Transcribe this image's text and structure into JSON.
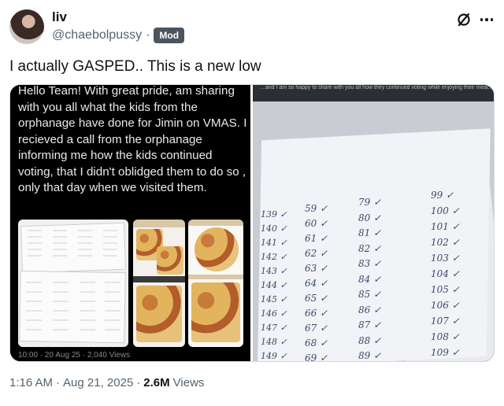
{
  "author": {
    "display_name": "liv",
    "handle": "@chaebolpussy",
    "separator": "·",
    "badge": "Mod"
  },
  "actions": {
    "grok_icon": "slashed-circle-icon",
    "more_icon": "more-dots-icon"
  },
  "tweet": {
    "text": "I actually GASPED.. This is a new low"
  },
  "media": {
    "left_caption": "Hello Team! With great pride, am sharing with you all what the kids from the orphanage have done for Jimin on VMAS. I recieved a call from the orphanage informing me how the kids continued voting, that I didn't oblidged them to do so , only that day when we visited them.",
    "left_bottom_fragment": "10:00 · 20 Aug 25 · 2,040 Views",
    "right_top_fragment": "...and I am so happy to share with you all how they continued voting while enjoying their meal...",
    "sheet_columns": [
      [
        "139",
        "140",
        "141",
        "142",
        "143",
        "144",
        "145",
        "146",
        "147",
        "148",
        "149"
      ],
      [
        "59",
        "60",
        "61",
        "62",
        "63",
        "64",
        "65",
        "66",
        "67",
        "68",
        "69"
      ],
      [
        "79",
        "80",
        "81",
        "82",
        "83",
        "84",
        "85",
        "86",
        "87",
        "88",
        "89"
      ],
      [
        "99",
        "100",
        "101",
        "102",
        "103",
        "104",
        "105",
        "106",
        "107",
        "108",
        "109"
      ]
    ]
  },
  "footer": {
    "time": "1:16 AM",
    "dot1": "·",
    "date": "Aug 21, 2025",
    "dot2": "·",
    "views_count": "2.6M",
    "views_label": "Views"
  }
}
